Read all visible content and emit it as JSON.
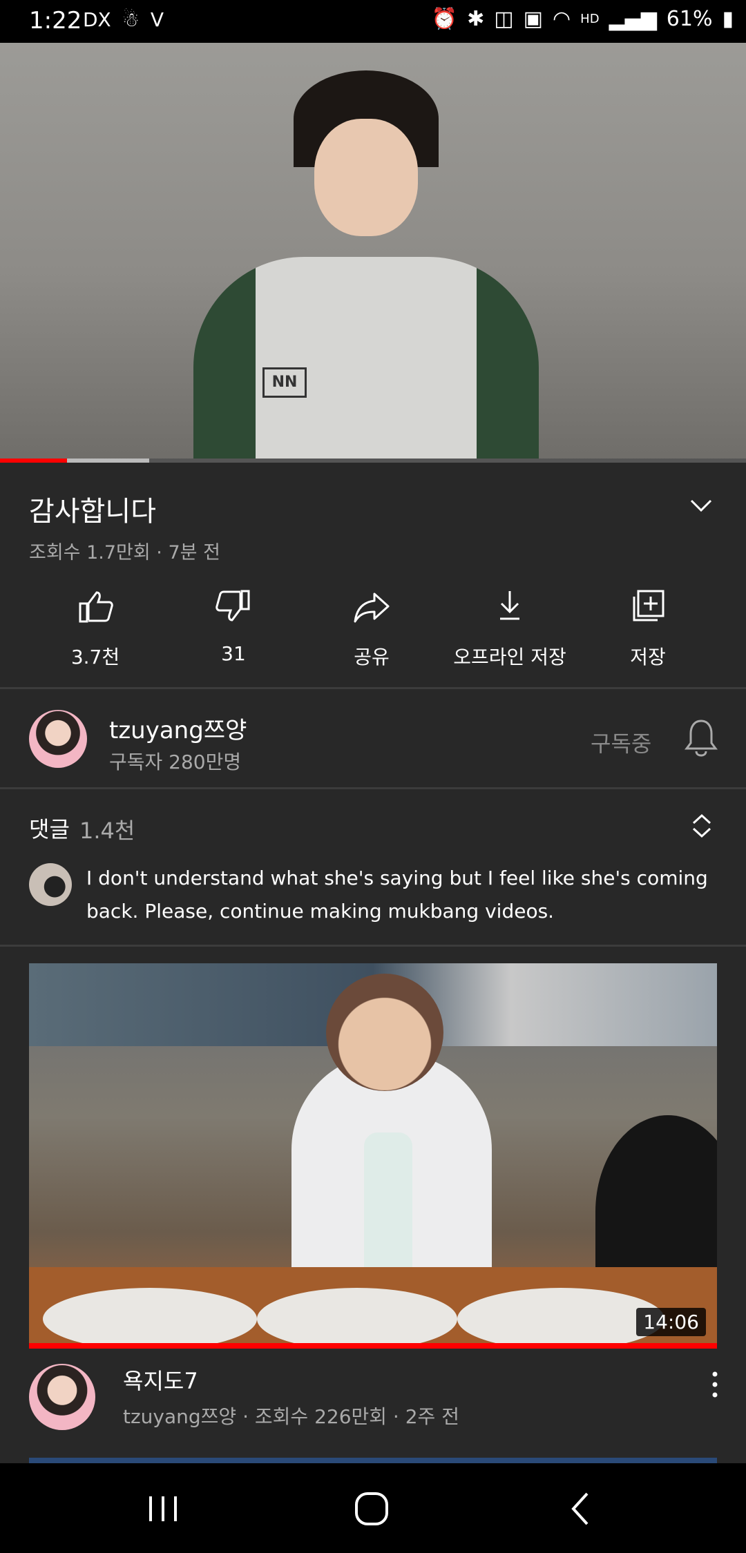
{
  "status_bar": {
    "time": "1:22",
    "left_icons": [
      "dex-icon",
      "app-notification-icon",
      "volte-icon"
    ],
    "battery": "61%",
    "right_icons": [
      "alarm-icon",
      "bluetooth-icon",
      "vibrate-icon",
      "battery-saver-icon",
      "wifi-icon",
      "hd-voice-icon",
      "signal-icon",
      "battery-icon"
    ]
  },
  "player": {
    "progress_played": 0.09,
    "progress_buffered": 0.2,
    "shirt_logo": "NN"
  },
  "video": {
    "title": "감사합니다",
    "meta": "조회수 1.7만회 · 7분 전"
  },
  "actions": [
    {
      "label": "3.7천",
      "icon": "thumbs-up-icon"
    },
    {
      "label": "31",
      "icon": "thumbs-down-icon"
    },
    {
      "label": "공유",
      "icon": "share-icon"
    },
    {
      "label": "오프라인 저장",
      "icon": "download-icon"
    },
    {
      "label": "저장",
      "icon": "add-to-playlist-icon"
    }
  ],
  "channel": {
    "name": "tzuyang쯔양",
    "subscribers": "구독자 280만명",
    "subscribe_state": "구독중"
  },
  "comments": {
    "label": "댓글",
    "count": "1.4천",
    "top_comment": "I don't understand what she's saying but I feel like she's coming back. Please, continue making mukbang videos."
  },
  "next_video": {
    "duration": "14:06",
    "title": "욕지도7",
    "meta": "tzuyang쯔양 · 조회수 226만회 · 2주 전"
  },
  "colors": {
    "background": "#282828",
    "accent_red": "#ff0000",
    "secondary_text": "#aaaaaa"
  }
}
